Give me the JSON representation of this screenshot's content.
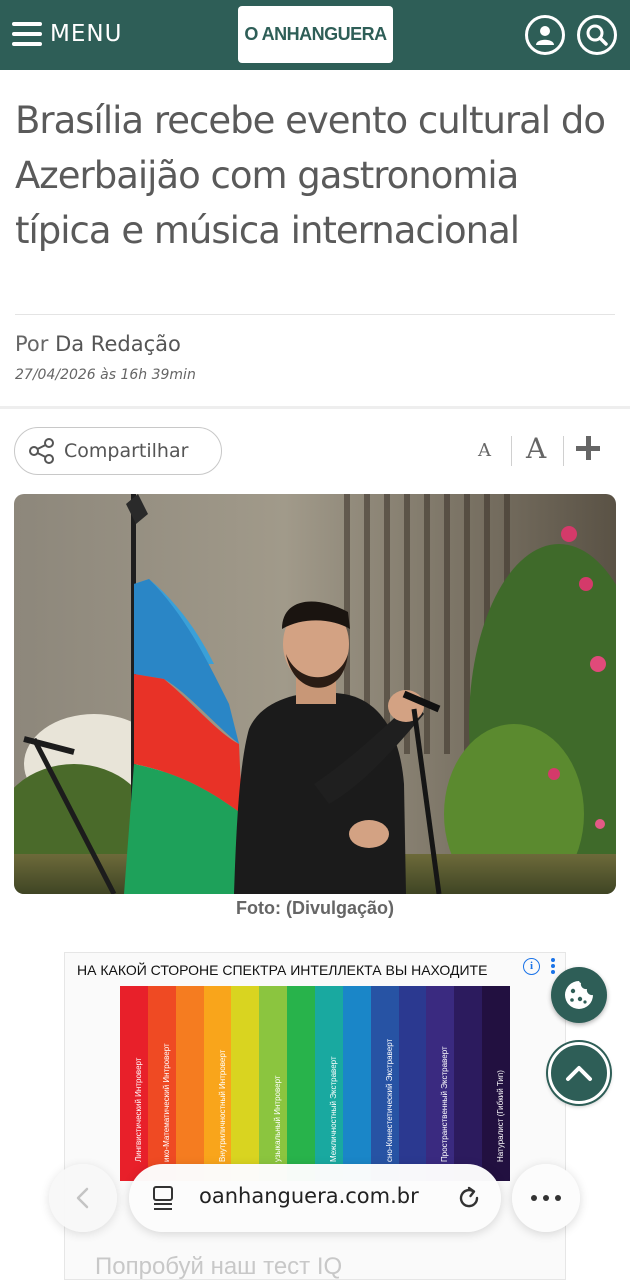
{
  "header": {
    "menu_label": "MENU",
    "logo_text": "O ANHANGUERA",
    "brand_color": "#2e5e57"
  },
  "article": {
    "title": "Brasília recebe evento cultural do Azerbaijão com gastronomia típica e música internacional",
    "byline_prefix": "Por",
    "author": "Da Redação",
    "date": "27/04/2026 às 16h 39min"
  },
  "tools": {
    "share_label": "Compartilhar",
    "font_small": "A",
    "font_large": "A",
    "font_increase": "+"
  },
  "photo": {
    "caption": "Foto: (Divulgação)"
  },
  "ad": {
    "headline": "НА КАКОЙ СТОРОНЕ СПЕКТРА ИНТЕЛЛЕКТА ВЫ НАХОДИТЕ",
    "info_icon": "info-icon",
    "spectrum": [
      {
        "label": "Лингвистический Интроверт",
        "color": "#e8202a"
      },
      {
        "label": "ико-Математический Интроверт",
        "color": "#ef4a23"
      },
      {
        "label": "",
        "color": "#f57c20"
      },
      {
        "label": "Внутриличностный Интроверт",
        "color": "#f9a51b"
      },
      {
        "label": "",
        "color": "#d9d420"
      },
      {
        "label": "узыкальный Интроверт",
        "color": "#8bc53f"
      },
      {
        "label": "",
        "color": "#28b34b"
      },
      {
        "label": "Межличностный Экстраверт",
        "color": "#19a9a0"
      },
      {
        "label": "",
        "color": "#1a86c8"
      },
      {
        "label": "сно-Кинестетический Экстраверт",
        "color": "#2753a4"
      },
      {
        "label": "",
        "color": "#2b3990"
      },
      {
        "label": "Пространственный Экстраверт",
        "color": "#3a2a80"
      },
      {
        "label": "",
        "color": "#2c1b5e"
      },
      {
        "label": "Натуралист (Гибкий Тип)",
        "color": "#221040"
      }
    ],
    "subheadline": "Попробуй наш тест IQ"
  },
  "browser": {
    "url": "oanhanguera.com.br"
  }
}
